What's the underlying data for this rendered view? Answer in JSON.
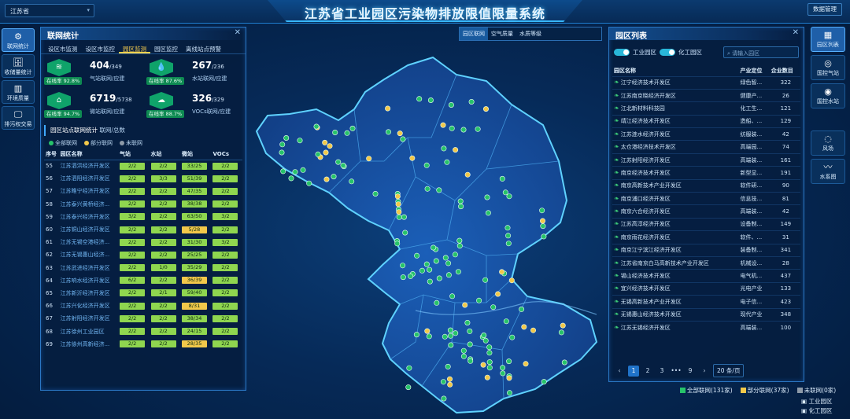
{
  "header": {
    "title": "江苏省工业园区污染物排放限值限量系统",
    "province": "江苏省",
    "admin_btn": "数据管理"
  },
  "left_nav": [
    {
      "label": "联网统计",
      "icon": "network-icon",
      "glyph": "⚙",
      "active": true
    },
    {
      "label": "收储量统计",
      "icon": "database-icon",
      "glyph": "🗄",
      "active": false
    },
    {
      "label": "环境质量",
      "icon": "chart-icon",
      "glyph": "▥",
      "active": false
    },
    {
      "label": "排污权交易",
      "icon": "monitor-icon",
      "glyph": "🖵",
      "active": false
    }
  ],
  "stats_panel": {
    "title": "联网统计",
    "tabs": [
      "设区市监测",
      "设区市监控",
      "园区监测",
      "园区监控",
      "离线站点预警"
    ],
    "active_tab": 2,
    "stats": [
      {
        "value": "404",
        "total": "/349",
        "label": "气站联网/应建",
        "rate": "在线率 92.8%",
        "glyph": "≋",
        "icon": "wind-icon"
      },
      {
        "value": "267",
        "total": "/236",
        "label": "水站联网/应建",
        "rate": "在线率 87.6%",
        "glyph": "💧",
        "icon": "water-icon"
      },
      {
        "value": "6719",
        "total": "/5738",
        "label": "微站联网/应建",
        "rate": "在线率 94.7%",
        "glyph": "⌂",
        "icon": "house-icon"
      },
      {
        "value": "326",
        "total": "/329",
        "label": "VOCs联网/应建",
        "rate": "在线率 88.7%",
        "glyph": "☁",
        "icon": "cloud-icon"
      }
    ],
    "section_title": "园区站点联网统计",
    "section_sub": "联网/总数",
    "legend": [
      {
        "label": "全部联网",
        "color": "#27c36a"
      },
      {
        "label": "部分联网",
        "color": "#f2c84a"
      },
      {
        "label": "未联网",
        "color": "#8d9aa8"
      }
    ],
    "columns": [
      "序号",
      "园区名称",
      "气站",
      "水站",
      "微站",
      "VOCs"
    ],
    "rows": [
      {
        "no": "55",
        "name": "江苏泗洪经济开发区",
        "air": "2/2",
        "water": "2/2",
        "micro": "33/25",
        "vocs": "2/2",
        "micro_part": false
      },
      {
        "no": "56",
        "name": "江苏泗阳经济开发区",
        "air": "2/2",
        "water": "3/3",
        "micro": "51/39",
        "vocs": "2/2",
        "micro_part": false
      },
      {
        "no": "57",
        "name": "江苏睢宁经济开发区",
        "air": "2/2",
        "water": "2/2",
        "micro": "47/35",
        "vocs": "2/2",
        "micro_part": false
      },
      {
        "no": "58",
        "name": "江苏泰兴黄桥经济...",
        "air": "2/2",
        "water": "2/2",
        "micro": "38/38",
        "vocs": "2/2",
        "micro_part": false
      },
      {
        "no": "59",
        "name": "江苏泰兴经济开发区",
        "air": "3/2",
        "water": "2/2",
        "micro": "63/50",
        "vocs": "3/2",
        "micro_part": false
      },
      {
        "no": "60",
        "name": "江苏铜山经济开发区",
        "air": "2/2",
        "water": "2/2",
        "micro": "5/28",
        "vocs": "2/2",
        "micro_part": true
      },
      {
        "no": "61",
        "name": "江苏无锡空港经济...",
        "air": "2/2",
        "water": "2/2",
        "micro": "31/30",
        "vocs": "3/2",
        "micro_part": false
      },
      {
        "no": "62",
        "name": "江苏无锡惠山经济...",
        "air": "2/2",
        "water": "2/2",
        "micro": "25/25",
        "vocs": "2/2",
        "micro_part": false
      },
      {
        "no": "63",
        "name": "江苏武进经济开发区",
        "air": "2/2",
        "water": "1/0",
        "micro": "35/29",
        "vocs": "2/2",
        "micro_part": false
      },
      {
        "no": "64",
        "name": "江苏响水经济开发区",
        "air": "6/2",
        "water": "2/2",
        "micro": "36/39",
        "vocs": "2/2",
        "micro_part": true
      },
      {
        "no": "65",
        "name": "江苏新沂经济开发区",
        "air": "2/2",
        "water": "2/1",
        "micro": "59/40",
        "vocs": "2/2",
        "micro_part": false
      },
      {
        "no": "66",
        "name": "江苏兴化经济开发区",
        "air": "2/2",
        "water": "2/2",
        "micro": "8/31",
        "vocs": "2/2",
        "micro_part": true
      },
      {
        "no": "67",
        "name": "江苏射阳经济开发区",
        "air": "2/2",
        "water": "2/2",
        "micro": "38/34",
        "vocs": "2/2",
        "micro_part": false
      },
      {
        "no": "68",
        "name": "江苏徐州工业园区",
        "air": "2/2",
        "water": "2/2",
        "micro": "24/15",
        "vocs": "2/2",
        "micro_part": false
      },
      {
        "no": "69",
        "name": "江苏徐州高新经济...",
        "air": "2/2",
        "water": "2/2",
        "micro": "28/35",
        "vocs": "2/2",
        "micro_part": true
      }
    ]
  },
  "layer_switch": {
    "options": [
      "园区联网",
      "空气质量",
      "水质等级"
    ],
    "active": 0
  },
  "park_list": {
    "title": "园区列表",
    "toggle_industrial": "工业园区",
    "toggle_chemical": "化工园区",
    "search_placeholder": "请输入园区",
    "columns": [
      "园区名称",
      "产业定位",
      "企业数目"
    ],
    "rows": [
      {
        "name": "江宁经济技术开发区",
        "industry": "绿色智...",
        "count": "322"
      },
      {
        "name": "江苏南京晓经济开发区",
        "industry": "健康产...",
        "count": "26"
      },
      {
        "name": "江北新材料科技园",
        "industry": "化工生...",
        "count": "121"
      },
      {
        "name": "靖江经济技术开发区",
        "industry": "造船、...",
        "count": "129"
      },
      {
        "name": "江苏涟水经济开发区",
        "industry": "纺服装...",
        "count": "42"
      },
      {
        "name": "太仓港经济技术开发区",
        "industry": "高端园...",
        "count": "74"
      },
      {
        "name": "江苏射阳经济开发区",
        "industry": "高端装...",
        "count": "161"
      },
      {
        "name": "南京经济技术开发区",
        "industry": "新型显...",
        "count": "191"
      },
      {
        "name": "南京高新技术产业开发区",
        "industry": "软件研...",
        "count": "90"
      },
      {
        "name": "南京浦口经济开发区",
        "industry": "信息技...",
        "count": "81"
      },
      {
        "name": "南京六合经济开发区",
        "industry": "高端装...",
        "count": "42"
      },
      {
        "name": "江苏高淳经济开发区",
        "industry": "设备制...",
        "count": "149"
      },
      {
        "name": "南京雨花经济开发区",
        "industry": "软件、...",
        "count": "31"
      },
      {
        "name": "南京江宁滨江经济开发区",
        "industry": "装备制...",
        "count": "341"
      },
      {
        "name": "江苏省南京白马高新技术产业开发区",
        "industry": "机械设...",
        "count": "28"
      },
      {
        "name": "锡山经济技术开发区",
        "industry": "电气机...",
        "count": "437"
      },
      {
        "name": "宜兴经济技术开发区",
        "industry": "光电产业",
        "count": "133"
      },
      {
        "name": "无锡高新技术产业开发区",
        "industry": "电子信...",
        "count": "423"
      },
      {
        "name": "无锡惠山经济技术开发区",
        "industry": "现代产业",
        "count": "348"
      },
      {
        "name": "江苏无锡经济开发区",
        "industry": "高端装...",
        "count": "100"
      }
    ],
    "pager": {
      "pages": [
        "1",
        "2",
        "3",
        "•••",
        "9"
      ],
      "page_size": "20 条/页",
      "prev": "‹",
      "next": "›"
    }
  },
  "right_nav": [
    {
      "label": "园区列表",
      "icon": "building-icon",
      "glyph": "▦",
      "active": true
    },
    {
      "label": "国控气站",
      "icon": "air-station-icon",
      "glyph": "◎",
      "active": false
    },
    {
      "label": "国控水站",
      "icon": "water-station-icon",
      "glyph": "◉",
      "active": false
    },
    {
      "label": "风场",
      "icon": "wind-field-icon",
      "glyph": "◌",
      "active": false
    },
    {
      "label": "水系图",
      "icon": "river-icon",
      "glyph": "〰",
      "active": false
    }
  ],
  "map_legend": [
    {
      "label": "全部联网(131家)",
      "color": "#27c36a"
    },
    {
      "label": "部分联网(37家)",
      "color": "#f2c84a"
    },
    {
      "label": "未联网(0家)",
      "color": "#8d9aa8"
    }
  ],
  "zone_legend": [
    "工业园区",
    "化工园区"
  ],
  "colors": {
    "accent": "#3fa8ff",
    "connected": "#27c36a",
    "partial": "#f2c84a",
    "offline": "#8d9aa8"
  }
}
